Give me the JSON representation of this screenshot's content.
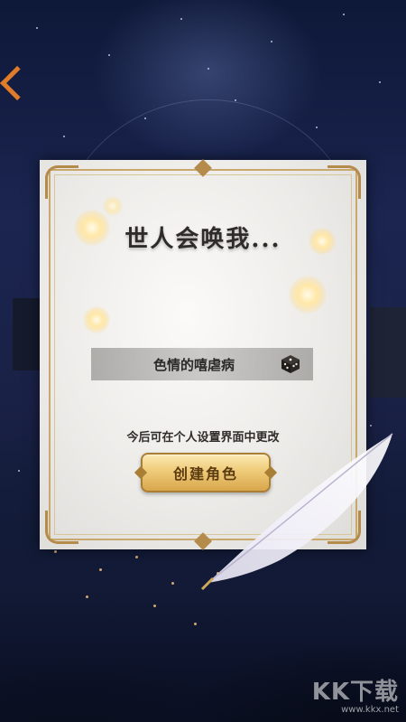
{
  "dialog": {
    "title": "世人会唤我...",
    "name_value": "色情的嘻虐病",
    "hint": "今后可在个人设置界面中更改",
    "create_button_label": "创建角色"
  },
  "icons": {
    "randomize": "dice-icon",
    "quill": "feather-quill-icon"
  },
  "watermark": {
    "logo": "KK下载",
    "url": "www.kkx.net"
  },
  "colors": {
    "button_gold": "#efcb79",
    "frame_gold": "#c9a86e",
    "night_sky": "#1b2550"
  }
}
